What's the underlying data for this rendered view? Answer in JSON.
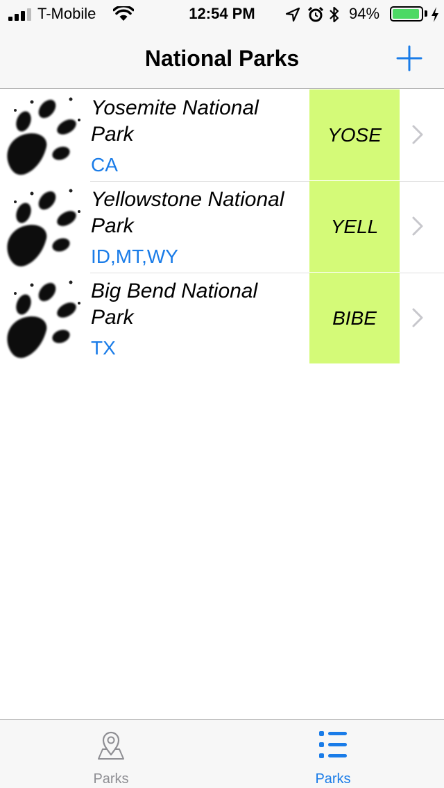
{
  "status_bar": {
    "carrier": "T-Mobile",
    "time": "12:54 PM",
    "battery_percent": "94%",
    "battery_level": 0.94,
    "icons": [
      "signal-icon",
      "wifi-icon",
      "location-icon",
      "alarm-icon",
      "bluetooth-icon",
      "battery-icon",
      "charging-icon"
    ]
  },
  "nav": {
    "title": "National Parks",
    "add_icon": "plus-icon"
  },
  "parks": [
    {
      "name": "Yosemite National Park",
      "states": "CA",
      "code": "YOSE",
      "icon": "paw-icon"
    },
    {
      "name": "Yellowstone National Park",
      "states": "ID,MT,WY",
      "code": "YELL",
      "icon": "paw-icon"
    },
    {
      "name": "Big Bend National Park",
      "states": "TX",
      "code": "BIBE",
      "icon": "paw-icon"
    }
  ],
  "tabs": [
    {
      "label": "Parks",
      "icon": "map-pin-icon",
      "selected": false
    },
    {
      "label": "Parks",
      "icon": "list-icon",
      "selected": true
    }
  ],
  "colors": {
    "accent": "#1a7ce8",
    "code_background": "#d4fa78",
    "inactive_tab": "#8e8e93",
    "battery": "#4cd964"
  }
}
